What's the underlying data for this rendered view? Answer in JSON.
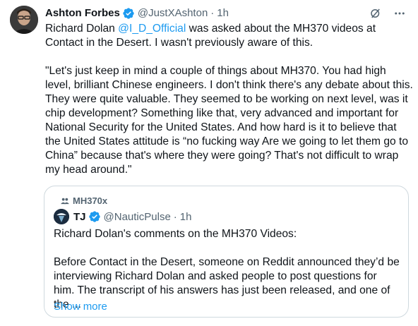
{
  "author": {
    "display_name": "Ashton Forbes",
    "handle": "@JustXAshton",
    "separator": "·",
    "time": "1h"
  },
  "tweet": {
    "text_before_mention": "Richard Dolan ",
    "mention": "@I_D_Official",
    "text_after_mention": " was asked about the MH370 videos at Contact in the Desert. I wasn't previously aware of this.\n\n\"Let's just keep in mind a couple of things about MH370. You had high level, brilliant Chinese engineers. I don't think there's any debate about this. They were quite valuable. They seemed to be working on next level, was it chip development? Something like that, very advanced and important for National Security for the United States. And how hard is it to believe that the United States attitude is “no fucking way Are we going to let them go to China” because that's where they were going? That's not difficult to wrap my head around.\""
  },
  "quote": {
    "community": "MH370x",
    "display_name": "TJ",
    "handle": "@NauticPulse",
    "separator": "·",
    "time": "1h",
    "text": "Richard Dolan's comments on the MH370 Videos:\n\nBefore Contact in the Desert, someone on Reddit announced they’d be interviewing Richard Dolan and asked people to post questions for him. The transcript of his answers has just been released, and one of the ...",
    "show_more": "Show more"
  },
  "icons": {
    "verified": "verified-badge-icon",
    "grok": "grok-icon",
    "more": "more-icon",
    "community": "people-icon"
  },
  "colors": {
    "accent": "#1d9bf0",
    "text": "#0f1419",
    "secondary": "#536471",
    "border": "#cfd9de"
  }
}
